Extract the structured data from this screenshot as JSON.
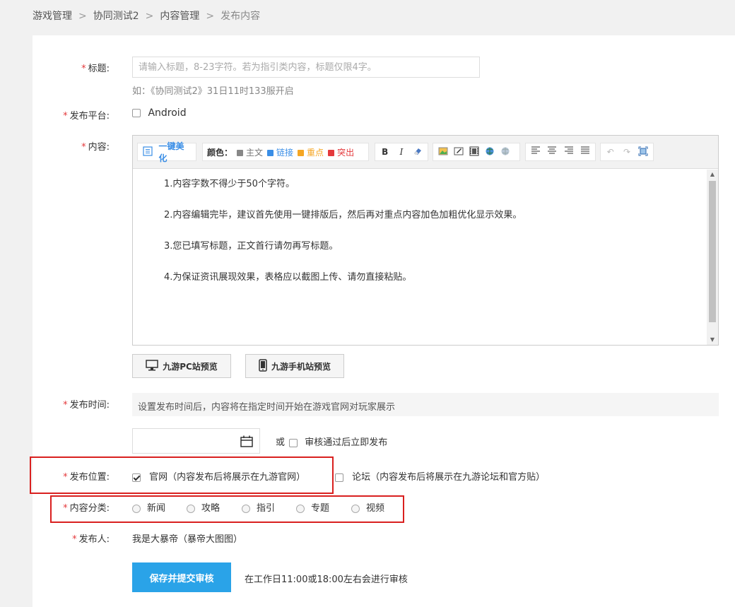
{
  "breadcrumb": {
    "items": [
      "游戏管理",
      "协同测试2",
      "内容管理"
    ],
    "separator": ">",
    "current": "发布内容"
  },
  "form": {
    "required_mark": "*",
    "title": {
      "label": "标题:",
      "placeholder": "请输入标题，8-23字符。若为指引类内容，标题仅限4字。",
      "hint": "如：《协同测试2》31日11时133服开启"
    },
    "platform": {
      "label": "发布平台:",
      "option": "Android",
      "checked": false
    },
    "content": {
      "label": "内容:",
      "toolbar": {
        "beautify": "一键美化",
        "color_label": "颜色：",
        "colors": [
          {
            "label": "主文",
            "color": "#888888"
          },
          {
            "label": "链接",
            "color": "#3a8ee6"
          },
          {
            "label": "重点",
            "color": "#f5a623"
          },
          {
            "label": "突出",
            "color": "#e4393c"
          }
        ],
        "format_icons": [
          "bold-icon",
          "italic-icon",
          "eraser-icon"
        ],
        "insert_icons": [
          "image-icon",
          "edit-image-icon",
          "video-icon",
          "link-icon",
          "unlink-icon"
        ],
        "align_icons": [
          "align-left-icon",
          "align-center-icon",
          "align-right-icon",
          "align-justify-icon"
        ],
        "history_icons": [
          "undo-icon",
          "redo-icon",
          "fullscreen-icon"
        ],
        "bold_glyph": "B",
        "italic_glyph": "I"
      },
      "lines": [
        "1.内容字数不得少于50个字符。",
        "2.内容编辑完毕，建议首先使用一键排版后，然后再对重点内容加色加粗优化显示效果。",
        "3.您已填写标题，正文首行请勿再写标题。",
        "4.为保证资讯展现效果，表格应以截图上传、请勿直接粘贴。"
      ]
    },
    "preview": {
      "pc": "九游PC站预览",
      "mobile": "九游手机站预览"
    },
    "publish_time": {
      "label": "发布时间:",
      "note": "设置发布时间后，内容将在指定时间开始在游戏官网对玩家展示",
      "or": "或",
      "immediate": "审核通过后立即发布"
    },
    "position": {
      "label": "发布位置:",
      "options": [
        {
          "label": "官网（内容发布后将展示在九游官网）",
          "checked": true
        },
        {
          "label": "论坛（内容发布后将展示在九游论坛和官方贴）",
          "checked": false
        }
      ]
    },
    "category": {
      "label": "内容分类:",
      "options": [
        "新闻",
        "攻略",
        "指引",
        "专题",
        "视频"
      ]
    },
    "publisher": {
      "label": "发布人:",
      "value": "我是大暴帝（暴帝大图图）"
    },
    "submit": {
      "label": "保存并提交审核",
      "note": "在工作日11:00或18:00左右会进行审核"
    }
  },
  "colors": {
    "accent": "#2aa3e8",
    "required": "#e4393c",
    "highlight_box": "#d9201f"
  }
}
